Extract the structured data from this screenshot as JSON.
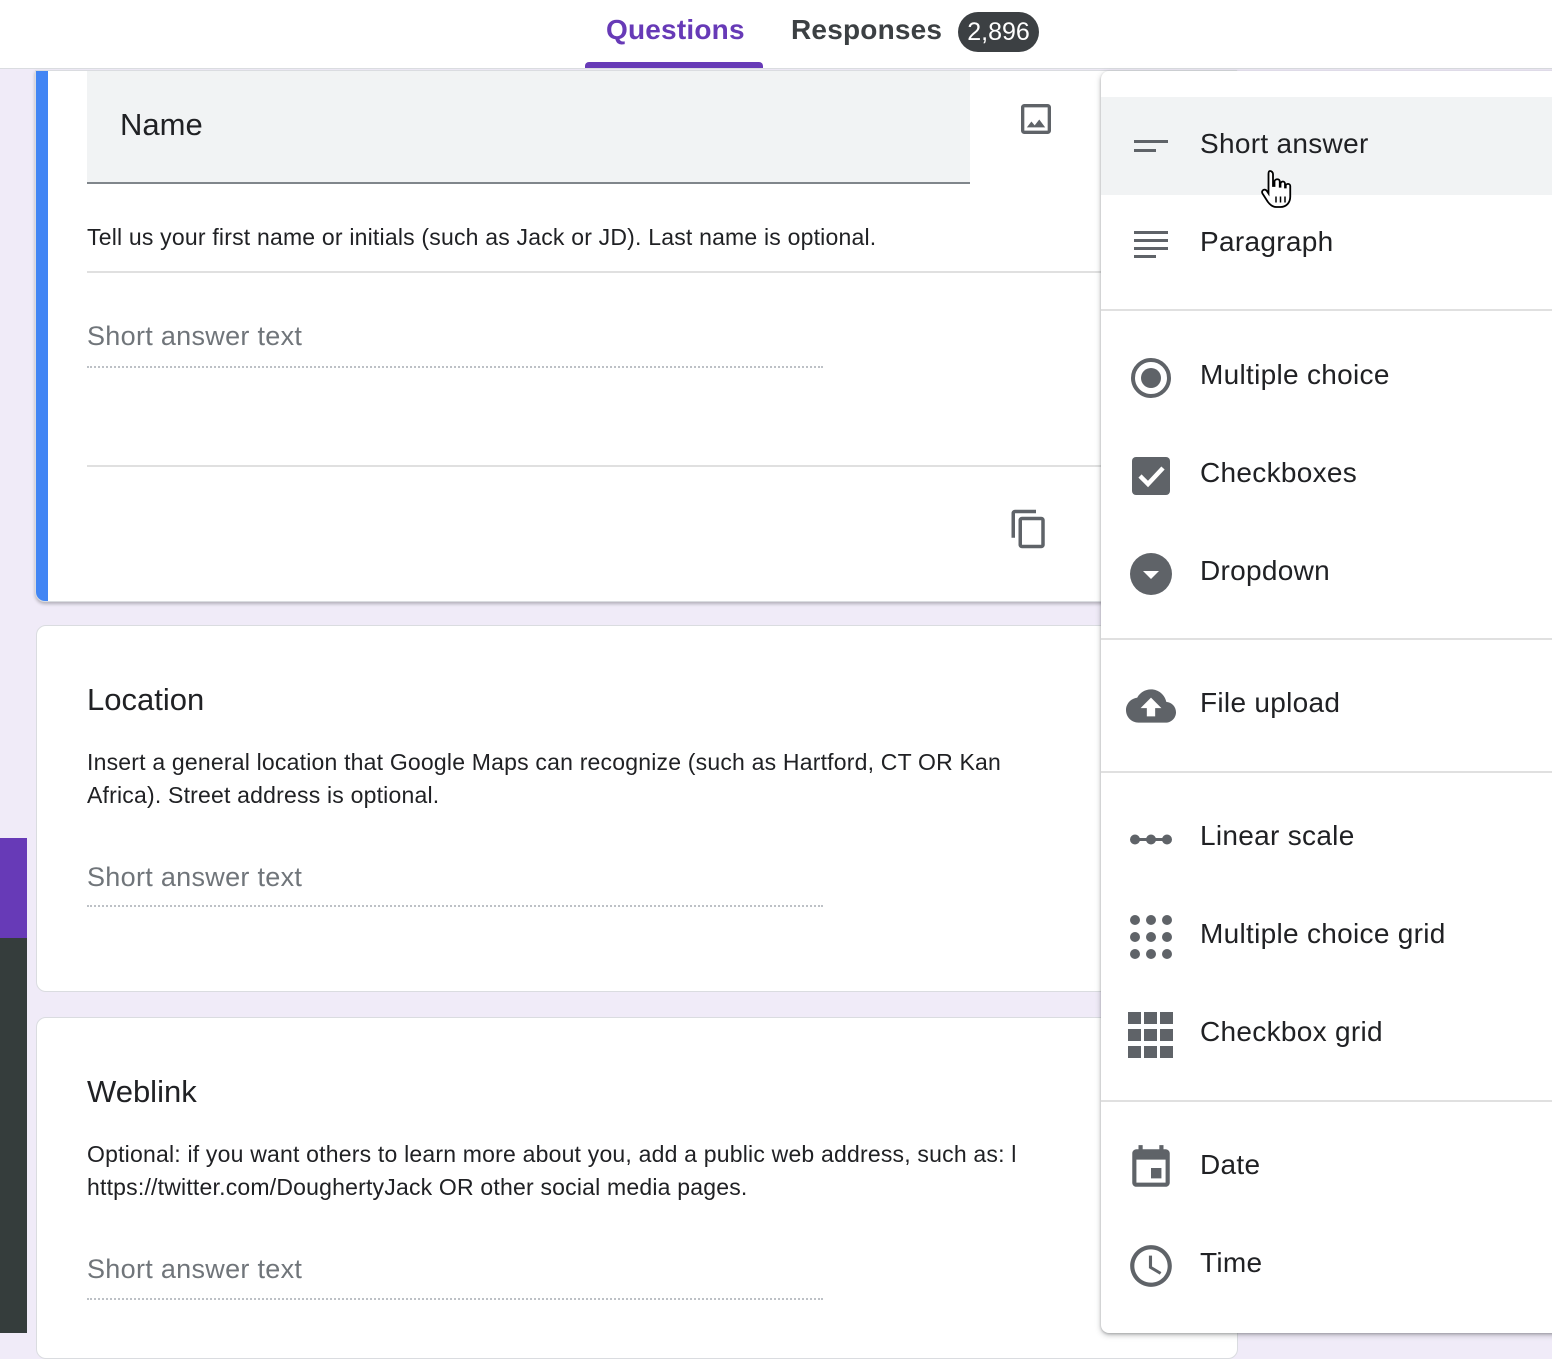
{
  "tabs": {
    "questions": "Questions",
    "responses": "Responses",
    "responses_count": "2,896"
  },
  "questions": [
    {
      "title": "Name",
      "description": "Tell us your first name or initials (such as Jack or JD). Last name is optional.",
      "answer_placeholder": "Short answer text"
    },
    {
      "title": "Location",
      "description_line1": "Insert a general location that Google Maps can recognize (such as Hartford, CT  OR   Kan",
      "description_line2": "Africa). Street address is optional.",
      "answer_placeholder": "Short answer text"
    },
    {
      "title": "Weblink",
      "description_line1": "Optional: if you want others to learn more about you, add a public web address, such as: l",
      "description_line2": "https://twitter.com/DoughertyJack  OR  other social media pages.",
      "answer_placeholder": "Short answer text"
    }
  ],
  "type_menu": {
    "items": [
      {
        "label": "Short answer",
        "icon": "short-answer-icon",
        "hovered": true
      },
      {
        "label": "Paragraph",
        "icon": "paragraph-icon"
      },
      {
        "label": "Multiple choice",
        "icon": "radio-button-icon"
      },
      {
        "label": "Checkboxes",
        "icon": "checkbox-icon"
      },
      {
        "label": "Dropdown",
        "icon": "dropdown-icon"
      },
      {
        "label": "File upload",
        "icon": "cloud-upload-icon"
      },
      {
        "label": "Linear scale",
        "icon": "linear-scale-icon"
      },
      {
        "label": "Multiple choice grid",
        "icon": "dot-grid-icon"
      },
      {
        "label": "Checkbox grid",
        "icon": "square-grid-icon"
      },
      {
        "label": "Date",
        "icon": "calendar-icon"
      },
      {
        "label": "Time",
        "icon": "clock-icon"
      }
    ]
  },
  "colors": {
    "accent": "#673ab7",
    "active_card": "#4285f4",
    "background": "#f0ebf8"
  }
}
